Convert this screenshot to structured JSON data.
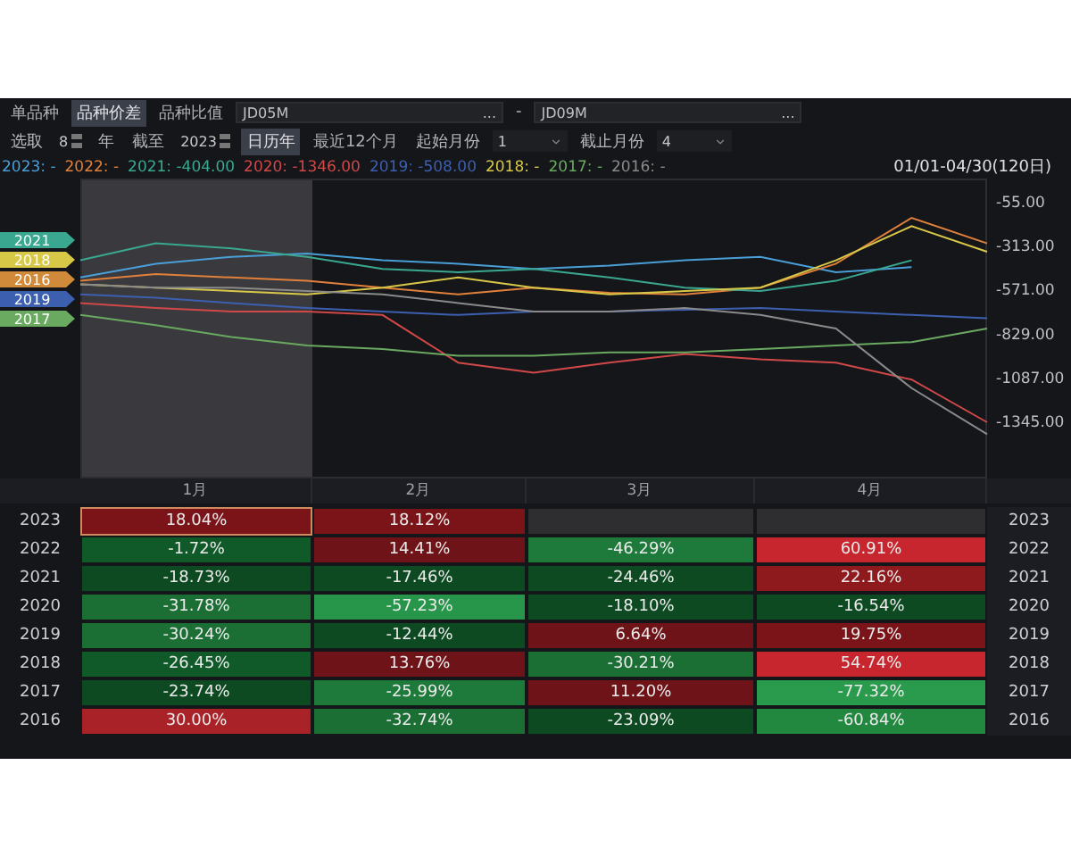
{
  "tabs": [
    {
      "label": "单品种",
      "selected": false
    },
    {
      "label": "品种价差",
      "selected": true
    },
    {
      "label": "品种比值",
      "selected": false
    }
  ],
  "contract_a": {
    "value": "JD05M",
    "button": "..."
  },
  "separator": "-",
  "contract_b": {
    "value": "JD09M",
    "button": "..."
  },
  "controls": {
    "pick_label": "选取",
    "years": "8",
    "years_unit": "年",
    "until_label": "截至",
    "until_year": "2023",
    "start_month_label": "起始月份",
    "start_month": "1",
    "end_month_label": "截止月份",
    "end_month": "4"
  },
  "range_modes": [
    {
      "label": "日历年",
      "selected": true
    },
    {
      "label": "最近12个月",
      "selected": false
    }
  ],
  "legend": [
    {
      "text": "2023: -",
      "color": "#4a9fd8"
    },
    {
      "text": "2022: -",
      "color": "#e0803a"
    },
    {
      "text": "2021: -404.00",
      "color": "#3aa890"
    },
    {
      "text": "2020: -1346.00",
      "color": "#d04848"
    },
    {
      "text": "2019: -508.00",
      "color": "#3d5fb0"
    },
    {
      "text": "2018: -",
      "color": "#d8c848"
    },
    {
      "text": "2017: -",
      "color": "#6aaa60"
    },
    {
      "text": "2016: -",
      "color": "#8a8a8a"
    }
  ],
  "date_range": "01/01-04/30(120日)",
  "year_tags": [
    {
      "label": "2021",
      "color": "#3aa890"
    },
    {
      "label": "2018",
      "color": "#d8c848"
    },
    {
      "label": "2016",
      "color": "#d08a3a"
    },
    {
      "label": "2019",
      "color": "#3d5fb0"
    },
    {
      "label": "2017",
      "color": "#6aaa60"
    }
  ],
  "chart_data": {
    "type": "line",
    "categories": [
      null,
      null,
      null,
      null,
      null,
      null,
      null,
      null,
      null,
      null,
      null,
      null,
      null
    ],
    "ylim": [
      -1680,
      80
    ],
    "yticks": [
      {
        "value": -55,
        "label": "-55.00"
      },
      {
        "value": -313,
        "label": "-313.00"
      },
      {
        "value": -571,
        "label": "-571.00"
      },
      {
        "value": -829,
        "label": "-829.00"
      },
      {
        "value": -1087,
        "label": "-1087.00"
      },
      {
        "value": -1345,
        "label": "-1345.00"
      }
    ],
    "series": [
      {
        "color": "#4a9fd8",
        "values": [
          -500,
          -420,
          -380,
          -360,
          -400,
          -420,
          -450,
          -430,
          -400,
          -380,
          -470,
          -440,
          null
        ]
      },
      {
        "color": "#e0803a",
        "values": [
          -520,
          -480,
          -500,
          -520,
          -560,
          -600,
          -560,
          -590,
          -600,
          -560,
          -420,
          -150,
          -300
        ]
      },
      {
        "color": "#3aa890",
        "values": [
          -400,
          -300,
          -330,
          -380,
          -450,
          -470,
          -450,
          -500,
          -560,
          -580,
          -520,
          -400,
          null
        ]
      },
      {
        "color": "#d04848",
        "values": [
          -650,
          -680,
          -700,
          -700,
          -720,
          -1000,
          -1060,
          -1000,
          -950,
          -980,
          -1000,
          -1100,
          -1350
        ]
      },
      {
        "color": "#3d5fb0",
        "values": [
          -600,
          -620,
          -650,
          -680,
          -700,
          -720,
          -700,
          -700,
          -690,
          -680,
          -700,
          -720,
          -740
        ]
      },
      {
        "color": "#d8c848",
        "values": [
          -540,
          -560,
          -580,
          -600,
          -560,
          -500,
          -560,
          -600,
          -580,
          -560,
          -400,
          -200,
          -350
        ]
      },
      {
        "color": "#6aaa60",
        "values": [
          -720,
          -780,
          -850,
          -900,
          -920,
          -960,
          -960,
          -940,
          -940,
          -920,
          -900,
          -880,
          -800
        ]
      },
      {
        "color": "#8a8a8a",
        "values": [
          -540,
          -560,
          -560,
          -580,
          -600,
          -650,
          -700,
          -700,
          -680,
          -720,
          -800,
          -1150,
          -1420
        ]
      }
    ]
  },
  "table": {
    "columns": [
      "1月",
      "2月",
      "3月",
      "4月"
    ],
    "rows": [
      {
        "year": "2023",
        "year_end": "2023",
        "cells": [
          {
            "value": "18.04%",
            "color": "#7a1418",
            "selected": true
          },
          {
            "value": "18.12%",
            "color": "#7a1418",
            "selected": false
          },
          {
            "color": "#2e2e30",
            "selected": false
          },
          {
            "color": "#2e2e30",
            "selected": false
          }
        ]
      },
      {
        "year": "2022",
        "year_end": "2022",
        "cells": [
          {
            "value": "-1.72%",
            "color": "#0f5a28",
            "selected": false
          },
          {
            "value": "14.41%",
            "color": "#6e1418",
            "selected": false
          },
          {
            "value": "-46.29%",
            "color": "#1d7a3a",
            "selected": false
          },
          {
            "value": "60.91%",
            "color": "#c8262e",
            "selected": false
          }
        ]
      },
      {
        "year": "2021",
        "year_end": "2021",
        "cells": [
          {
            "value": "-18.73%",
            "color": "#0d4a22",
            "selected": false
          },
          {
            "value": "-17.46%",
            "color": "#0d4a22",
            "selected": false
          },
          {
            "value": "-24.46%",
            "color": "#0d4a22",
            "selected": false
          },
          {
            "value": "22.16%",
            "color": "#8e1a1e",
            "selected": false
          }
        ]
      },
      {
        "year": "2020",
        "year_end": "2020",
        "cells": [
          {
            "value": "-31.78%",
            "color": "#1b6e34",
            "selected": false
          },
          {
            "value": "-57.23%",
            "color": "#27964a",
            "selected": false
          },
          {
            "value": "-18.10%",
            "color": "#0d4a22",
            "selected": false
          },
          {
            "value": "-16.54%",
            "color": "#0d4a22",
            "selected": false
          }
        ]
      },
      {
        "year": "2019",
        "year_end": "2019",
        "cells": [
          {
            "value": "-30.24%",
            "color": "#1b6e34",
            "selected": false
          },
          {
            "value": "-12.44%",
            "color": "#0d4a22",
            "selected": false
          },
          {
            "value": "6.64%",
            "color": "#6e1418",
            "selected": false
          },
          {
            "value": "19.75%",
            "color": "#7a1418",
            "selected": false
          }
        ]
      },
      {
        "year": "2018",
        "year_end": "2018",
        "cells": [
          {
            "value": "-26.45%",
            "color": "#0f5a28",
            "selected": false
          },
          {
            "value": "13.76%",
            "color": "#6e1418",
            "selected": false
          },
          {
            "value": "-30.21%",
            "color": "#1b6e34",
            "selected": false
          },
          {
            "value": "54.74%",
            "color": "#c8262e",
            "selected": false
          }
        ]
      },
      {
        "year": "2017",
        "year_end": "2017",
        "cells": [
          {
            "value": "-23.74%",
            "color": "#0d4a22",
            "selected": false
          },
          {
            "value": "-25.99%",
            "color": "#1d7a3a",
            "selected": false
          },
          {
            "value": "11.20%",
            "color": "#6e1418",
            "selected": false
          },
          {
            "value": "-77.32%",
            "color": "#2a9a4c",
            "selected": false
          }
        ]
      },
      {
        "year": "2016",
        "year_end": "2016",
        "cells": [
          {
            "value": "30.00%",
            "color": "#a82228",
            "selected": false
          },
          {
            "value": "-32.74%",
            "color": "#1b6e34",
            "selected": false
          },
          {
            "value": "-23.09%",
            "color": "#0d4a22",
            "selected": false
          },
          {
            "value": "-60.84%",
            "color": "#22883f",
            "selected": false
          }
        ]
      }
    ]
  }
}
